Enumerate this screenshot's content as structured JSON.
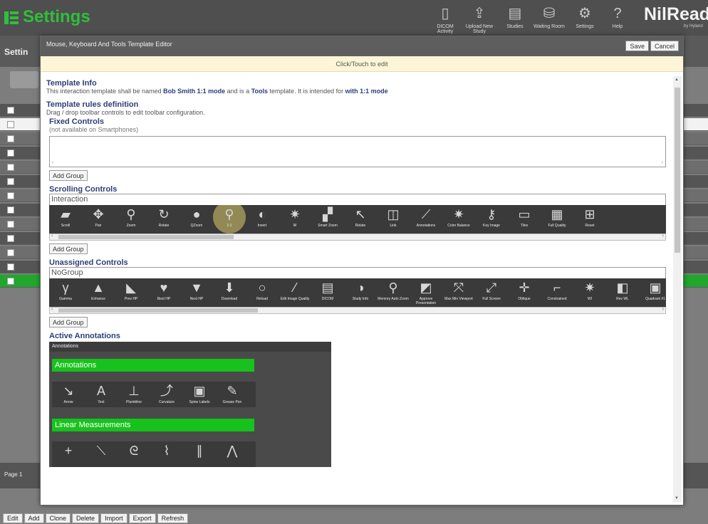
{
  "app": {
    "title": "Settings",
    "brand": "NilRead",
    "brand_sub": "by Hyland"
  },
  "topnav": [
    {
      "label": "DICOM Activity",
      "icon": "file-icon",
      "glyph": "▯"
    },
    {
      "label": "Upload New Study",
      "icon": "upload-icon",
      "glyph": "⇪"
    },
    {
      "label": "Studies",
      "icon": "studies-icon",
      "glyph": "▤"
    },
    {
      "label": "Waiting Room",
      "icon": "waiting-room-icon",
      "glyph": "⛁"
    },
    {
      "label": "Settings",
      "icon": "gear-icon",
      "glyph": "⚙"
    },
    {
      "label": "Help",
      "icon": "help-icon",
      "glyph": "?"
    }
  ],
  "background": {
    "subheader": "Settin",
    "footer": "Page 1"
  },
  "bottom_buttons": [
    "Edit",
    "Add",
    "Clone",
    "Delete",
    "Import",
    "Export",
    "Refresh"
  ],
  "dialog": {
    "title": "Mouse, Keyboard And Tools Template Editor",
    "save": "Save",
    "cancel": "Cancel",
    "click_hint": "Click/Touch to edit"
  },
  "template_info": {
    "heading": "Template Info",
    "p1": "This interaction template shall be named",
    "name": "Bob Smith 1:1 mode",
    "p2": "and is a",
    "type": "Tools",
    "p3": "template. It is intended for",
    "intent": "with 1:1 mode"
  },
  "rules": {
    "heading": "Template rules definition",
    "desc": "Drag / drop toolbar controls to edit toolbar configuration."
  },
  "fixed": {
    "heading": "Fixed Controls",
    "note": "(not available on Smartphones)",
    "add_group": "Add Group"
  },
  "scrolling": {
    "heading": "Scrolling Controls",
    "group": "Interaction",
    "add_group": "Add Group",
    "tools": [
      {
        "label": "Scroll",
        "icon": "scroll-icon",
        "glyph": "▰"
      },
      {
        "label": "Pan",
        "icon": "pan-icon",
        "glyph": "✥"
      },
      {
        "label": "Zoom",
        "icon": "zoom-icon",
        "glyph": "⚲"
      },
      {
        "label": "Rotate",
        "icon": "rotate-icon",
        "glyph": "↻"
      },
      {
        "label": "QZoom",
        "icon": "qzoom-icon",
        "glyph": "●"
      },
      {
        "label": "1:1",
        "icon": "one-to-one-icon",
        "glyph": "⚲"
      },
      {
        "label": "Invert",
        "icon": "invert-icon",
        "glyph": "◐"
      },
      {
        "label": "W",
        "icon": "window-level-icon",
        "glyph": "✷"
      },
      {
        "label": "Smart Zoom",
        "icon": "smart-zoom-icon",
        "glyph": "▞"
      },
      {
        "label": "Relate",
        "icon": "relate-icon",
        "glyph": "↖"
      },
      {
        "label": "Link",
        "icon": "link-icon",
        "glyph": "◫"
      },
      {
        "label": "Annotations",
        "icon": "annotations-icon",
        "glyph": "⟋"
      },
      {
        "label": "Color Balance",
        "icon": "color-balance-icon",
        "glyph": "✷"
      },
      {
        "label": "Key Image",
        "icon": "key-image-icon",
        "glyph": "⚷"
      },
      {
        "label": "Tiles",
        "icon": "tiles-icon",
        "glyph": "▭"
      },
      {
        "label": "Full Quality",
        "icon": "full-quality-icon",
        "glyph": "▦"
      },
      {
        "label": "Reset",
        "icon": "reset-icon",
        "glyph": "⊞"
      }
    ]
  },
  "unassigned": {
    "heading": "Unassigned Controls",
    "group": "NoGroup",
    "add_group": "Add Group",
    "tools": [
      {
        "label": "Gamma",
        "icon": "gamma-icon",
        "glyph": "γ"
      },
      {
        "label": "Enhance",
        "icon": "enhance-icon",
        "glyph": "▲"
      },
      {
        "label": "Prev HP",
        "icon": "prev-hp-icon",
        "glyph": "◣"
      },
      {
        "label": "Best HP",
        "icon": "best-hp-icon",
        "glyph": "♥"
      },
      {
        "label": "Next HP",
        "icon": "next-hp-icon",
        "glyph": "▼"
      },
      {
        "label": "Download",
        "icon": "download-icon",
        "glyph": "⬇"
      },
      {
        "label": "Reload",
        "icon": "reload-icon",
        "glyph": "○"
      },
      {
        "label": "Edit Image Quality",
        "icon": "edit-quality-icon",
        "glyph": "⁄"
      },
      {
        "label": "DICOM",
        "icon": "dicom-icon",
        "glyph": "▤"
      },
      {
        "label": "Study Info",
        "icon": "study-info-icon",
        "glyph": "◑"
      },
      {
        "label": "Memory Auto Zoom",
        "icon": "memory-zoom-icon",
        "glyph": "⚲"
      },
      {
        "label": "Approve Presentation",
        "icon": "approve-icon",
        "glyph": "◩"
      },
      {
        "label": "Max Min Viewport",
        "icon": "max-min-icon",
        "glyph": "⤧"
      },
      {
        "label": "Full Screen",
        "icon": "full-screen-icon",
        "glyph": "⤢"
      },
      {
        "label": "Oblique",
        "icon": "oblique-icon",
        "glyph": "✛"
      },
      {
        "label": "Constrained",
        "icon": "constrained-icon",
        "glyph": "⌐"
      },
      {
        "label": "WI",
        "icon": "wi-icon",
        "glyph": "✷"
      },
      {
        "label": "Rev WL",
        "icon": "rev-wl-icon",
        "glyph": "◧"
      },
      {
        "label": "Quadrant #1",
        "icon": "quadrant-icon",
        "glyph": "▣"
      }
    ]
  },
  "active": {
    "heading": "Active Annotations",
    "panel_title": "Annotations",
    "annotations": {
      "label": "Annotations",
      "tools": [
        {
          "label": "Arrow",
          "icon": "arrow-icon",
          "glyph": "↘"
        },
        {
          "label": "Text",
          "icon": "text-icon",
          "glyph": "A"
        },
        {
          "label": "Plumbline",
          "icon": "plumbline-icon",
          "glyph": "⊥"
        },
        {
          "label": "Curvature",
          "icon": "curvature-icon",
          "glyph": "⤴"
        },
        {
          "label": "Spine Labels",
          "icon": "spine-labels-icon",
          "glyph": "▣"
        },
        {
          "label": "Grease Pen",
          "icon": "grease-pen-icon",
          "glyph": "✎"
        }
      ]
    },
    "linear": {
      "label": "Linear Measurements",
      "tools": [
        {
          "label": "",
          "icon": "crosshair-icon",
          "glyph": "+"
        },
        {
          "label": "",
          "icon": "line-icon",
          "glyph": "⟍"
        },
        {
          "label": "",
          "icon": "freehand-icon",
          "glyph": "ᘓ"
        },
        {
          "label": "",
          "icon": "curve-icon",
          "glyph": "⌇"
        },
        {
          "label": "",
          "icon": "parallel-icon",
          "glyph": "∥"
        },
        {
          "label": "",
          "icon": "angle-icon",
          "glyph": "⋀"
        }
      ]
    }
  }
}
